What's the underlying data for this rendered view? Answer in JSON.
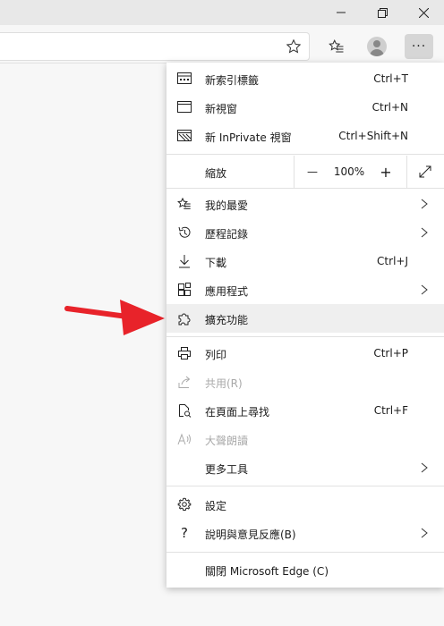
{
  "window": {
    "minimize_icon": "minimize-icon",
    "restore_icon": "restore-icon",
    "close_icon": "close-icon"
  },
  "toolbar": {
    "favorite_icon": "star-outline-icon",
    "favorites_icon": "favorites-list-icon",
    "profile_icon": "profile-avatar-icon",
    "more_label": "···"
  },
  "menu": {
    "new_tab": {
      "label": "新索引標籤",
      "shortcut": "Ctrl+T"
    },
    "new_window": {
      "label": "新視窗",
      "shortcut": "Ctrl+N"
    },
    "new_inprivate": {
      "label": "新 InPrivate 視窗",
      "shortcut": "Ctrl+Shift+N"
    },
    "zoom": {
      "label": "縮放",
      "minus": "—",
      "value": "100%",
      "plus": "+"
    },
    "favorites": {
      "label": "我的最愛"
    },
    "history": {
      "label": "歷程記錄"
    },
    "downloads": {
      "label": "下載",
      "shortcut": "Ctrl+J"
    },
    "apps": {
      "label": "應用程式"
    },
    "extensions": {
      "label": "擴充功能"
    },
    "print": {
      "label": "列印",
      "shortcut": "Ctrl+P"
    },
    "share": {
      "label": "共用(R)"
    },
    "find": {
      "label": "在頁面上尋找",
      "shortcut": "Ctrl+F"
    },
    "read_aloud": {
      "label": "大聲朗讀"
    },
    "more_tools": {
      "label": "更多工具"
    },
    "settings": {
      "label": "設定"
    },
    "help": {
      "label": "說明與意見反應(B)"
    },
    "close_edge": {
      "label": "關閉 Microsoft Edge (C)"
    }
  },
  "annotation": {
    "arrow_color": "#e8232a"
  }
}
